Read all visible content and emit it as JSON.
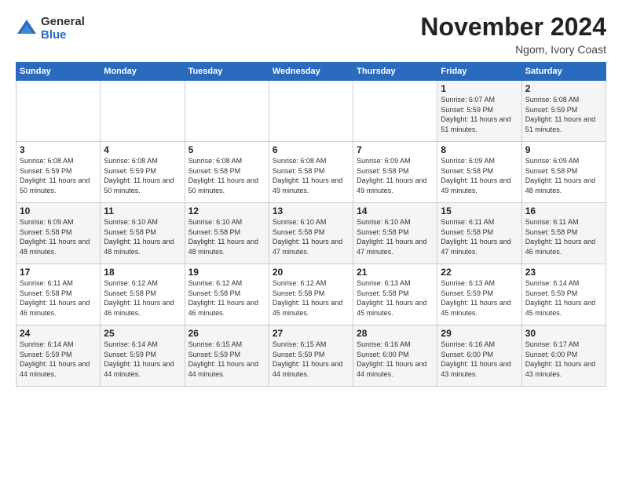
{
  "logo": {
    "general": "General",
    "blue": "Blue"
  },
  "header": {
    "title": "November 2024",
    "location": "Ngom, Ivory Coast"
  },
  "days_of_week": [
    "Sunday",
    "Monday",
    "Tuesday",
    "Wednesday",
    "Thursday",
    "Friday",
    "Saturday"
  ],
  "weeks": [
    [
      {
        "day": "",
        "info": ""
      },
      {
        "day": "",
        "info": ""
      },
      {
        "day": "",
        "info": ""
      },
      {
        "day": "",
        "info": ""
      },
      {
        "day": "",
        "info": ""
      },
      {
        "day": "1",
        "info": "Sunrise: 6:07 AM\nSunset: 5:59 PM\nDaylight: 11 hours and 51 minutes."
      },
      {
        "day": "2",
        "info": "Sunrise: 6:08 AM\nSunset: 5:59 PM\nDaylight: 11 hours and 51 minutes."
      }
    ],
    [
      {
        "day": "3",
        "info": "Sunrise: 6:08 AM\nSunset: 5:59 PM\nDaylight: 11 hours and 50 minutes."
      },
      {
        "day": "4",
        "info": "Sunrise: 6:08 AM\nSunset: 5:59 PM\nDaylight: 11 hours and 50 minutes."
      },
      {
        "day": "5",
        "info": "Sunrise: 6:08 AM\nSunset: 5:58 PM\nDaylight: 11 hours and 50 minutes."
      },
      {
        "day": "6",
        "info": "Sunrise: 6:08 AM\nSunset: 5:58 PM\nDaylight: 11 hours and 49 minutes."
      },
      {
        "day": "7",
        "info": "Sunrise: 6:09 AM\nSunset: 5:58 PM\nDaylight: 11 hours and 49 minutes."
      },
      {
        "day": "8",
        "info": "Sunrise: 6:09 AM\nSunset: 5:58 PM\nDaylight: 11 hours and 49 minutes."
      },
      {
        "day": "9",
        "info": "Sunrise: 6:09 AM\nSunset: 5:58 PM\nDaylight: 11 hours and 48 minutes."
      }
    ],
    [
      {
        "day": "10",
        "info": "Sunrise: 6:09 AM\nSunset: 5:58 PM\nDaylight: 11 hours and 48 minutes."
      },
      {
        "day": "11",
        "info": "Sunrise: 6:10 AM\nSunset: 5:58 PM\nDaylight: 11 hours and 48 minutes."
      },
      {
        "day": "12",
        "info": "Sunrise: 6:10 AM\nSunset: 5:58 PM\nDaylight: 11 hours and 48 minutes."
      },
      {
        "day": "13",
        "info": "Sunrise: 6:10 AM\nSunset: 5:58 PM\nDaylight: 11 hours and 47 minutes."
      },
      {
        "day": "14",
        "info": "Sunrise: 6:10 AM\nSunset: 5:58 PM\nDaylight: 11 hours and 47 minutes."
      },
      {
        "day": "15",
        "info": "Sunrise: 6:11 AM\nSunset: 5:58 PM\nDaylight: 11 hours and 47 minutes."
      },
      {
        "day": "16",
        "info": "Sunrise: 6:11 AM\nSunset: 5:58 PM\nDaylight: 11 hours and 46 minutes."
      }
    ],
    [
      {
        "day": "17",
        "info": "Sunrise: 6:11 AM\nSunset: 5:58 PM\nDaylight: 11 hours and 46 minutes."
      },
      {
        "day": "18",
        "info": "Sunrise: 6:12 AM\nSunset: 5:58 PM\nDaylight: 11 hours and 46 minutes."
      },
      {
        "day": "19",
        "info": "Sunrise: 6:12 AM\nSunset: 5:58 PM\nDaylight: 11 hours and 46 minutes."
      },
      {
        "day": "20",
        "info": "Sunrise: 6:12 AM\nSunset: 5:58 PM\nDaylight: 11 hours and 45 minutes."
      },
      {
        "day": "21",
        "info": "Sunrise: 6:13 AM\nSunset: 5:58 PM\nDaylight: 11 hours and 45 minutes."
      },
      {
        "day": "22",
        "info": "Sunrise: 6:13 AM\nSunset: 5:59 PM\nDaylight: 11 hours and 45 minutes."
      },
      {
        "day": "23",
        "info": "Sunrise: 6:14 AM\nSunset: 5:59 PM\nDaylight: 11 hours and 45 minutes."
      }
    ],
    [
      {
        "day": "24",
        "info": "Sunrise: 6:14 AM\nSunset: 5:59 PM\nDaylight: 11 hours and 44 minutes."
      },
      {
        "day": "25",
        "info": "Sunrise: 6:14 AM\nSunset: 5:59 PM\nDaylight: 11 hours and 44 minutes."
      },
      {
        "day": "26",
        "info": "Sunrise: 6:15 AM\nSunset: 5:59 PM\nDaylight: 11 hours and 44 minutes."
      },
      {
        "day": "27",
        "info": "Sunrise: 6:15 AM\nSunset: 5:59 PM\nDaylight: 11 hours and 44 minutes."
      },
      {
        "day": "28",
        "info": "Sunrise: 6:16 AM\nSunset: 6:00 PM\nDaylight: 11 hours and 44 minutes."
      },
      {
        "day": "29",
        "info": "Sunrise: 6:16 AM\nSunset: 6:00 PM\nDaylight: 11 hours and 43 minutes."
      },
      {
        "day": "30",
        "info": "Sunrise: 6:17 AM\nSunset: 6:00 PM\nDaylight: 11 hours and 43 minutes."
      }
    ]
  ]
}
